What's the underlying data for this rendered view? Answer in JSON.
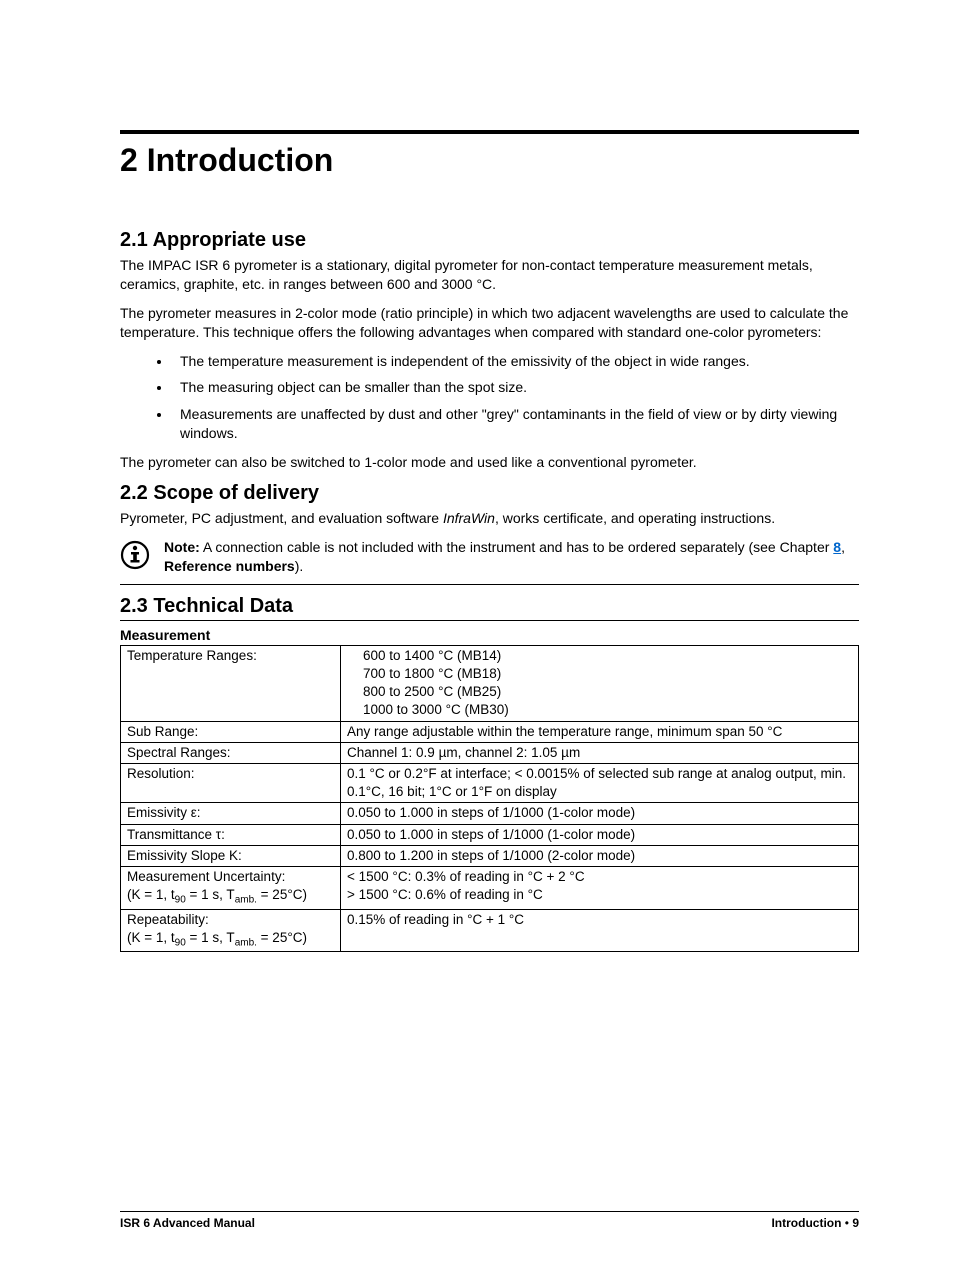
{
  "title": "2  Introduction",
  "sections": {
    "s21": {
      "heading": "2.1   Appropriate use",
      "p1": "The IMPAC ISR 6 pyrometer is a stationary, digital pyrometer for non-contact temperature measurement metals, ceramics, graphite, etc. in ranges between 600 and 3000 °C.",
      "p2": "The pyrometer measures in 2-color mode (ratio principle) in which two adjacent wavelengths are used to calculate the temperature. This technique offers the following advantages when compared with standard one-color pyrometers:",
      "b1": "The temperature measurement is independent of the emissivity of the object in wide ranges.",
      "b2": "The measuring object can be smaller than the spot size.",
      "b3": "Measurements are unaffected by dust and other \"grey\" contaminants in the field of view or by dirty viewing windows.",
      "p3": "The pyrometer can also be switched to 1-color mode and used like a conventional pyrometer."
    },
    "s22": {
      "heading": "2.2   Scope of delivery",
      "p1a": "Pyrometer, PC adjustment, and evaluation software ",
      "p1b": "InfraWin",
      "p1c": ", works certificate, and operating instructions.",
      "note_label": "Note:",
      "note_text1": "   A connection cable is not included with the instrument and has to be ordered separately (see Chapter ",
      "note_link": "8",
      "note_text2": ", ",
      "note_bold": "Reference numbers",
      "note_text3": ")."
    },
    "s23": {
      "heading": "2.3   Technical Data",
      "subheading": "Measurement",
      "rows": {
        "r1": {
          "label": "Temperature Ranges:",
          "l1": "600 to 1400 °C  (MB14)",
          "l2": "700 to 1800 °C  (MB18)",
          "l3": "800 to 2500 °C  (MB25)",
          "l4": "1000 to 3000 °C  (MB30)"
        },
        "r2": {
          "label": "Sub Range:",
          "val": "Any range adjustable within the temperature range, minimum span 50 °C"
        },
        "r3": {
          "label": "Spectral Ranges:",
          "val": "Channel 1: 0.9 µm, channel 2: 1.05 µm"
        },
        "r4": {
          "label": "Resolution:",
          "val": "0.1 °C or 0.2°F at interface; < 0.0015% of selected sub range at analog output, min. 0.1°C, 16 bit; 1°C or 1°F on display"
        },
        "r5": {
          "label": "Emissivity ε:",
          "val": "0.050 to 1.000 in steps of 1/1000 (1-color mode)"
        },
        "r6": {
          "label": "Transmittance τ:",
          "val": "0.050 to 1.000 in steps of 1/1000 (1-color mode)"
        },
        "r7": {
          "label": "Emissivity Slope K:",
          "val": "0.800 to 1.200 in steps of 1/1000 (2-color mode)"
        },
        "r8": {
          "label_l1": "Measurement Uncertainty:",
          "label_l2a": "(K = 1, t",
          "label_l2b": "90",
          "label_l2c": " = 1 s, T",
          "label_l2d": "amb.",
          "label_l2e": " = 25°C)",
          "l1": "< 1500 °C: 0.3% of reading in °C + 2 °C",
          "l2": "> 1500 °C: 0.6% of reading in °C"
        },
        "r9": {
          "label_l1": "Repeatability:",
          "label_l2a": "(K = 1, t",
          "label_l2b": "90",
          "label_l2c": " = 1 s, T",
          "label_l2d": "amb.",
          "label_l2e": " = 25°C)",
          "val": "0.15% of reading in °C + 1 °C"
        }
      }
    }
  },
  "footer": {
    "left": "ISR 6 Advanced Manual",
    "right_label": "Introduction",
    "right_bullet": " • ",
    "right_page": "  9"
  }
}
